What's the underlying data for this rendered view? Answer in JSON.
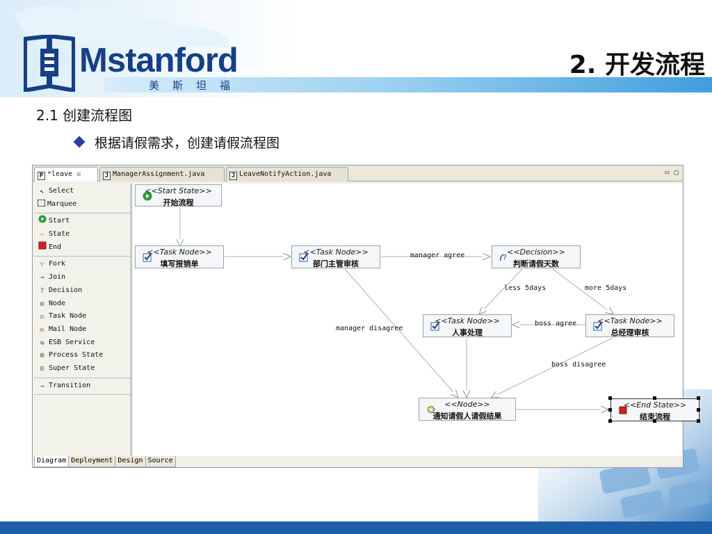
{
  "slide": {
    "logo_text": "Mstanford",
    "logo_cn": "美斯坦福",
    "title": "2. 开发流程",
    "subheading": "2.1 创建流程图",
    "bullet": "根据请假需求，创建请假流程图"
  },
  "editor": {
    "tabs": [
      {
        "icon": "P",
        "label": "*leave",
        "close": "☒"
      },
      {
        "icon": "J",
        "label": "ManagerAssignment.java"
      },
      {
        "icon": "J",
        "label": "LeaveNotifyAction.java"
      }
    ],
    "win_controls": "▭ ▢",
    "palette": {
      "sections": [
        [
          {
            "label": "Select",
            "icon": "arrow-cursor-icon"
          },
          {
            "label": "Marquee",
            "icon": "marquee-icon"
          }
        ],
        [
          {
            "label": "Start",
            "icon": "start-icon"
          },
          {
            "label": "State",
            "icon": "state-icon"
          },
          {
            "label": "End",
            "icon": "end-icon"
          }
        ],
        [
          {
            "label": "Fork",
            "icon": "fork-icon"
          },
          {
            "label": "Join",
            "icon": "join-icon"
          },
          {
            "label": "Decision",
            "icon": "decision-icon"
          },
          {
            "label": "Node",
            "icon": "node-gear-icon"
          },
          {
            "label": "Task Node",
            "icon": "task-node-icon"
          },
          {
            "label": "Mail Node",
            "icon": "mail-node-icon"
          },
          {
            "label": "ESB Service",
            "icon": "esb-service-icon"
          },
          {
            "label": "Process State",
            "icon": "process-state-icon"
          },
          {
            "label": "Super State",
            "icon": "super-state-icon"
          }
        ],
        [
          {
            "label": "Transition",
            "icon": "transition-arrow-icon"
          }
        ]
      ]
    },
    "nodes": {
      "start": {
        "stereotype": "<<Start State>>",
        "name": "开始流程"
      },
      "fill": {
        "stereotype": "<<Task Node>>",
        "name": "填写报销单"
      },
      "dept": {
        "stereotype": "<<Task Node>>",
        "name": "部门主管审核"
      },
      "decision": {
        "stereotype": "<<Decision>>",
        "name": "判断请假天数"
      },
      "hr": {
        "stereotype": "<<Task Node>>",
        "name": "人事处理"
      },
      "gm": {
        "stereotype": "<<Task Node>>",
        "name": "总经理审核"
      },
      "notify": {
        "stereotype": "<<Node>>",
        "name": "通知请假人请假结果"
      },
      "end": {
        "stereotype": "<<End State>>",
        "name": "结束流程"
      }
    },
    "transitions": {
      "manager_agree": "manager agree",
      "less_5days": "less 5days",
      "more_5days": "more 5days",
      "boss_agree": "boss agree",
      "manager_disagree": "manager disagree",
      "boss_disagree": "boss disagree"
    },
    "bottom_tabs": [
      "Diagram",
      "Deployment",
      "Design",
      "Source"
    ]
  },
  "colors": {
    "brand_blue": "#163f87",
    "footer_blue": "#1c5fa8",
    "start_green": "#2e9a3a",
    "end_red": "#d22020"
  }
}
